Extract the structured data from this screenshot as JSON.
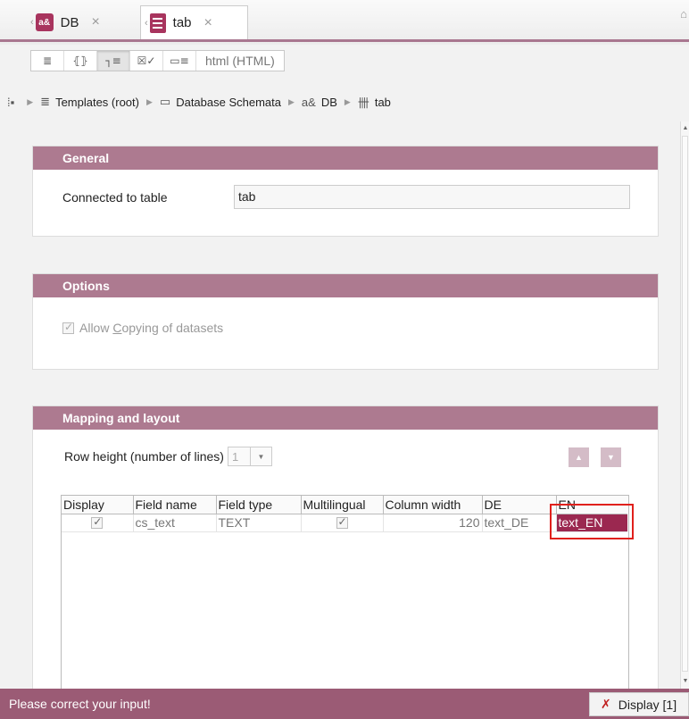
{
  "tabs": [
    {
      "label": "DB",
      "badge": "a&"
    },
    {
      "label": "tab"
    }
  ],
  "view_toolbar": {
    "buttons": [
      {
        "icon": "list-view-icon",
        "glyph": "≣"
      },
      {
        "icon": "code-view-icon",
        "glyph": "⦃⦄"
      },
      {
        "icon": "properties-view-icon",
        "glyph": "┐≡"
      },
      {
        "icon": "checklist-view-icon",
        "glyph": "☒✓"
      },
      {
        "icon": "fields-view-icon",
        "glyph": "▭≡"
      }
    ],
    "text_button": "html (HTML)"
  },
  "breadcrumb": [
    {
      "icon": "templates-icon",
      "glyph": "≣",
      "label": "Templates (root)"
    },
    {
      "icon": "folder-icon",
      "glyph": "▭",
      "label": "Database Schemata"
    },
    {
      "icon": "db-icon",
      "glyph": "a&",
      "label": "DB"
    },
    {
      "icon": "table-icon",
      "glyph": "卌",
      "label": "tab"
    }
  ],
  "general": {
    "title": "General",
    "connected_label": "Connected to table",
    "connected_value": "tab"
  },
  "options": {
    "title": "Options",
    "copy_prefix": "Allow ",
    "copy_mnemonic": "C",
    "copy_suffix": "opying of datasets",
    "copy_checked": true
  },
  "mapping": {
    "title": "Mapping and layout",
    "row_height_label": "Row height (number of lines)",
    "row_height_value": "1",
    "columns": [
      "Display",
      "Field name",
      "Field type",
      "Multilingual",
      "Column width",
      "DE",
      "EN"
    ],
    "rows": [
      {
        "display": true,
        "field_name": "cs_text",
        "field_type": "TEXT",
        "multilingual": true,
        "column_width": "120",
        "de": "text_DE",
        "en": "text_EN"
      }
    ]
  },
  "status": {
    "message": "Please correct your input!",
    "display_button": "Display [1]"
  },
  "colors": {
    "accent": "#9b2850",
    "panel_header": "#ad7a90",
    "status_bar": "#9b5b75",
    "error_outline": "#e0201c"
  }
}
